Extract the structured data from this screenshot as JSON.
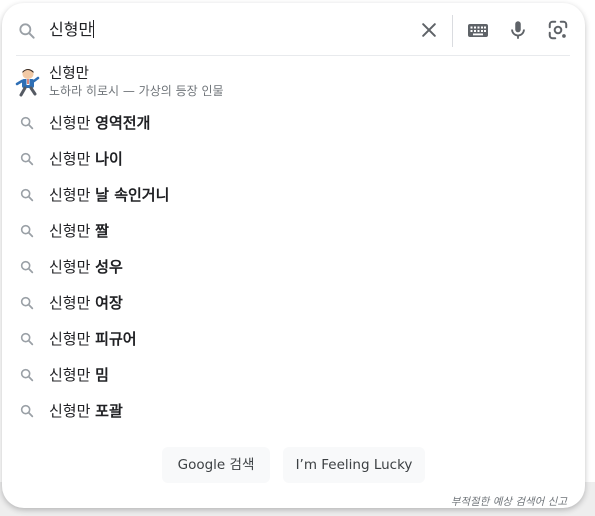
{
  "search": {
    "query": "신형만",
    "icon": "search-icon"
  },
  "toolbar": {
    "clear_icon": "close-icon",
    "keyboard_icon": "keyboard-icon",
    "mic_icon": "microphone-icon",
    "lens_icon": "camera-lens-icon"
  },
  "entity": {
    "title": "신형만",
    "description": "노하라 히로시 — 가상의 등장 인물",
    "thumbnail": "character-thumbnail"
  },
  "suggestions": [
    {
      "prefix": "신형만 ",
      "suffix": "영역전개"
    },
    {
      "prefix": "신형만 ",
      "suffix": "나이"
    },
    {
      "prefix": "신형만 ",
      "suffix": "날 속인거니"
    },
    {
      "prefix": "신형만 ",
      "suffix": "짤"
    },
    {
      "prefix": "신형만 ",
      "suffix": "성우"
    },
    {
      "prefix": "신형만 ",
      "suffix": "여장"
    },
    {
      "prefix": "신형만 ",
      "suffix": "피규어"
    },
    {
      "prefix": "신형만 ",
      "suffix": "밈"
    },
    {
      "prefix": "신형만 ",
      "suffix": "포괄"
    }
  ],
  "buttons": {
    "search_label": "Google 검색",
    "lucky_label": "I’m Feeling Lucky"
  },
  "footer": {
    "report_label": "부적절한 예상 검색어 신고"
  },
  "colors": {
    "text": "#202124",
    "secondary_text": "#70757a",
    "icon_gray": "#5f6368",
    "mic_blue": "#4285f4",
    "button_bg": "#f8f9fa",
    "divider": "#dadce0"
  }
}
